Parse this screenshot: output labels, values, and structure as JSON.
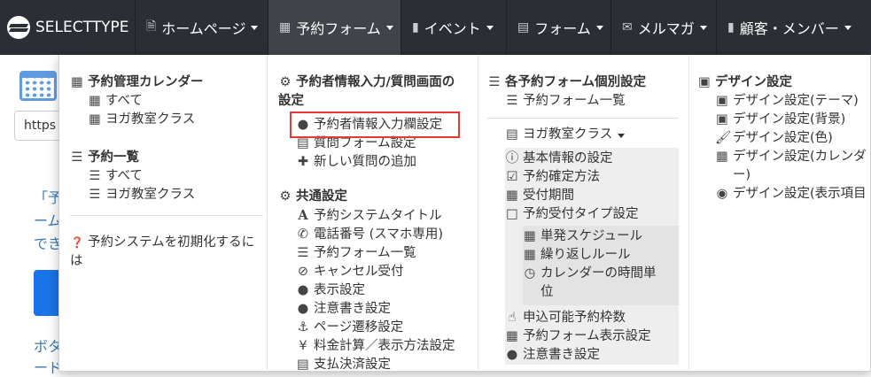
{
  "navbar": {
    "brand": "SELECTTYPE",
    "items": [
      {
        "label": "ホームページ",
        "icon": "file-icon"
      },
      {
        "label": "予約フォーム",
        "icon": "calendar-icon"
      },
      {
        "label": "イベント",
        "icon": "comment-icon"
      },
      {
        "label": "フォーム",
        "icon": "list-icon"
      },
      {
        "label": "メルマガ",
        "icon": "envelope-icon"
      },
      {
        "label": "顧客・メンバー",
        "icon": "book-icon"
      }
    ]
  },
  "background": {
    "url_text": "https",
    "line1": "「予",
    "line2": "ーム",
    "line3": "でき",
    "line4": "ボタ",
    "line5": "ード"
  },
  "menu": {
    "col1": {
      "calendar_head": "予約管理カレンダー",
      "calendar_items": [
        "すべて",
        "ヨガ教室クラス"
      ],
      "list_head": "予約一覧",
      "list_items": [
        "すべて",
        "ヨガ教室クラス"
      ],
      "reset_line1": "予約システムを初期化するに",
      "reset_line2": "は"
    },
    "col2": {
      "input_head_line1": "予約者情報入力/質問画面の",
      "input_head_line2": "設定",
      "input_items": [
        "予約者情報入力欄設定",
        "質問フォーム設定",
        "新しい質問の追加"
      ],
      "common_head": "共通設定",
      "common_items": [
        "予約システムタイトル",
        "電話番号 (スマホ専用)",
        "予約フォーム一覧",
        "キャンセル受付",
        "表示設定",
        "注意書き設定",
        "ページ遷移設定",
        "料金計算／表示方法設定",
        "支払決済設定"
      ]
    },
    "col3": {
      "head": "各予約フォーム個別設定",
      "form_list": "予約フォーム一覧",
      "class_toggle": "ヨガ教室クラス",
      "class_items": [
        "基本情報の設定",
        "予約確定方法",
        "受付期間",
        "予約受付タイプ設定"
      ],
      "type_items": [
        "単発スケジュール",
        "繰り返しルール"
      ],
      "calendar_unit_line1": "カレンダーの時間単",
      "calendar_unit_line2": "位",
      "more_items": [
        "申込可能予約枠数",
        "予約フォーム表示設定",
        "注意書き設定"
      ]
    },
    "col4": {
      "head": "デザイン設定",
      "items": [
        "デザイン設定(テーマ)",
        "デザイン設定(背景)",
        "デザイン設定(色)"
      ],
      "calendar_line1": "デザイン設定(カレンダ",
      "calendar_line2": "ー)",
      "display_item": "デザイン設定(表示項目"
    }
  }
}
